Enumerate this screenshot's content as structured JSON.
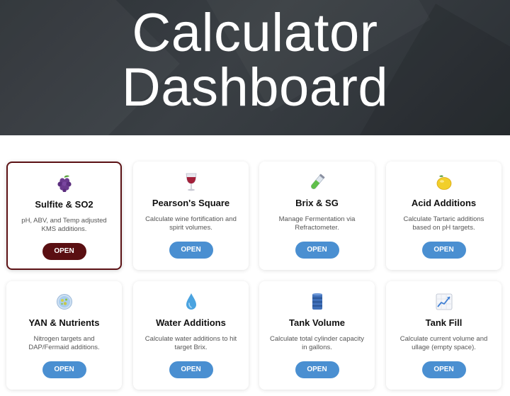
{
  "header": {
    "title_line1": "Calculator",
    "title_line2": "Dashboard"
  },
  "cards": [
    {
      "title": "Sulfite & SO2",
      "desc": "pH, ABV, and Temp adjusted KMS additions.",
      "button": "OPEN",
      "icon": "grapes-icon",
      "active": true
    },
    {
      "title": "Pearson's Square",
      "desc": "Calculate wine fortification and spirit volumes.",
      "button": "OPEN",
      "icon": "wine-glass-icon",
      "active": false
    },
    {
      "title": "Brix & SG",
      "desc": "Manage Fermentation via Refractometer.",
      "button": "OPEN",
      "icon": "test-tube-icon",
      "active": false
    },
    {
      "title": "Acid Additions",
      "desc": "Calculate Tartaric additions based on pH targets.",
      "button": "OPEN",
      "icon": "lemon-icon",
      "active": false
    },
    {
      "title": "YAN & Nutrients",
      "desc": "Nitrogen targets and DAP/Fermaid additions.",
      "button": "OPEN",
      "icon": "petri-dish-icon",
      "active": false
    },
    {
      "title": "Water Additions",
      "desc": "Calculate water additions to hit target Brix.",
      "button": "OPEN",
      "icon": "droplet-icon",
      "active": false
    },
    {
      "title": "Tank Volume",
      "desc": "Calculate total cylinder capacity in gallons.",
      "button": "OPEN",
      "icon": "barrel-icon",
      "active": false
    },
    {
      "title": "Tank Fill",
      "desc": "Calculate current volume and ullage (empty space).",
      "button": "OPEN",
      "icon": "chart-increasing-icon",
      "active": false
    }
  ],
  "colors": {
    "primary_button": "#4a8fd1",
    "active_button": "#5a0f12",
    "active_border": "#5c1215",
    "header_bg": "#33383d"
  }
}
